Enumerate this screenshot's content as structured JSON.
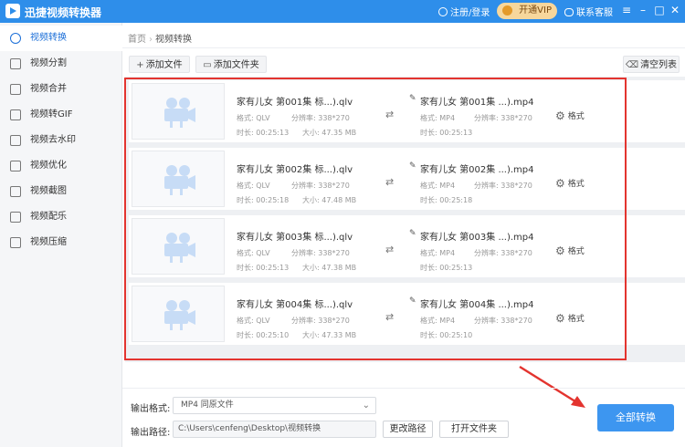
{
  "app": {
    "title": "迅捷视频转换器",
    "login_label": "注册/登录",
    "vip_label": "开通VIP",
    "support_label": "联系客服",
    "window_controls": [
      "menu-icon",
      "minimize-icon",
      "maximize-icon",
      "close-icon"
    ]
  },
  "sidebar": {
    "items": [
      {
        "label": "视频转换",
        "icon": "video-convert-icon",
        "active": true
      },
      {
        "label": "视频分割",
        "icon": "video-split-icon"
      },
      {
        "label": "视频合并",
        "icon": "video-merge-icon"
      },
      {
        "label": "视频转GIF",
        "icon": "video-gif-icon"
      },
      {
        "label": "视频去水印",
        "icon": "watermark-icon"
      },
      {
        "label": "视频优化",
        "icon": "optimize-icon"
      },
      {
        "label": "视频截图",
        "icon": "screenshot-icon"
      },
      {
        "label": "视频配乐",
        "icon": "music-icon"
      },
      {
        "label": "视频压缩",
        "icon": "compress-icon"
      }
    ]
  },
  "breadcrumb": {
    "home": "首页",
    "separator": "›",
    "current": "视频转换"
  },
  "toolbar": {
    "add_file": "添加文件",
    "add_folder": "添加文件夹",
    "clear_list": "清空列表"
  },
  "labels": {
    "format": "格式:",
    "resolution": "分辨率:",
    "size": "大小:",
    "duration": "时长:",
    "format_button": "格式"
  },
  "files": [
    {
      "source_name": "家有儿女 第001集 标...).qlv",
      "target_name": "家有儿女 第001集 ...).mp4",
      "source_format": "QLV",
      "target_format": "MP4",
      "resolution": "338*270",
      "size": "47.35 MB",
      "duration": "00:25:13",
      "target_duration": "00:25:13"
    },
    {
      "source_name": "家有儿女 第002集 标...).qlv",
      "target_name": "家有儿女 第002集 ...).mp4",
      "source_format": "QLV",
      "target_format": "MP4",
      "resolution": "338*270",
      "size": "47.48 MB",
      "duration": "00:25:18",
      "target_duration": "00:25:18"
    },
    {
      "source_name": "家有儿女 第003集 标...).qlv",
      "target_name": "家有儿女 第003集 ...).mp4",
      "source_format": "QLV",
      "target_format": "MP4",
      "resolution": "338*270",
      "size": "47.38 MB",
      "duration": "00:25:13",
      "target_duration": "00:25:13"
    },
    {
      "source_name": "家有儿女 第004集 标...).qlv",
      "target_name": "家有儿女 第004集 ...).mp4",
      "source_format": "QLV",
      "target_format": "MP4",
      "resolution": "338*270",
      "size": "47.33 MB",
      "duration": "00:25:10",
      "target_duration": "00:25:10"
    }
  ],
  "output": {
    "format_label": "输出格式:",
    "format_value": "MP4  同原文件",
    "path_label": "输出路径:",
    "path_value": "C:\\Users\\cenfeng\\Desktop\\视频转换",
    "change_path": "更改路径",
    "open_folder": "打开文件夹",
    "convert_all": "全部转换"
  },
  "colors": {
    "accent": "#2e8eea",
    "highlight_box": "#e3342f",
    "convert_button": "#3d96f0"
  }
}
